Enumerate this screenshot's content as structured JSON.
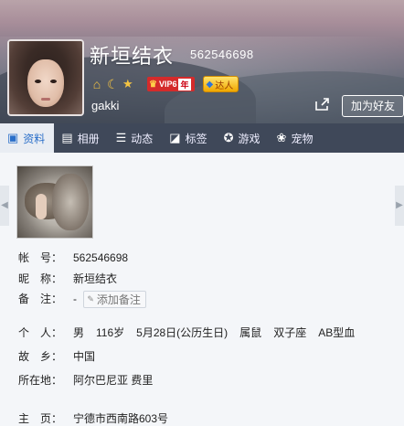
{
  "profile": {
    "name": "新垣结衣",
    "qq_number": "562546698",
    "nickname_en": "gakki",
    "badges": {
      "vip_label": "VIP6",
      "vip_year": "年",
      "daren_label": "达人"
    },
    "add_friend_label": "加为好友"
  },
  "tabs": [
    {
      "label": "资料",
      "icon": "profile-card-icon",
      "active": true
    },
    {
      "label": "相册",
      "icon": "photo-album-icon",
      "active": false
    },
    {
      "label": "动态",
      "icon": "feed-list-icon",
      "active": false
    },
    {
      "label": "标签",
      "icon": "tag-icon",
      "active": false
    },
    {
      "label": "游戏",
      "icon": "game-icon",
      "active": false
    },
    {
      "label": "宠物",
      "icon": "pet-paw-icon",
      "active": false
    }
  ],
  "details": {
    "account_label": "帐　号：",
    "account_value": "562546698",
    "nick_label": "昵　称：",
    "nick_value": "新垣结衣",
    "remark_label": "备　注：",
    "remark_dash": "-",
    "remark_button": "添加备注",
    "personal_label": "个　人：",
    "personal": {
      "gender": "男",
      "age": "116岁",
      "birthday": "5月28日(公历生日)",
      "zodiac": "属鼠",
      "constellation": "双子座",
      "blood": "AB型血"
    },
    "hometown_label": "故　乡：",
    "hometown_value": "中国",
    "location_label": "所在地：",
    "location_value": "阿尔巴尼亚 费里",
    "partial_label": "主　页：",
    "partial_value": "宁德市西南路603号"
  },
  "colors": {
    "tab_bar": "#3f4859",
    "active_tab": "#e9edf3",
    "accent": "#2a6fc9"
  }
}
